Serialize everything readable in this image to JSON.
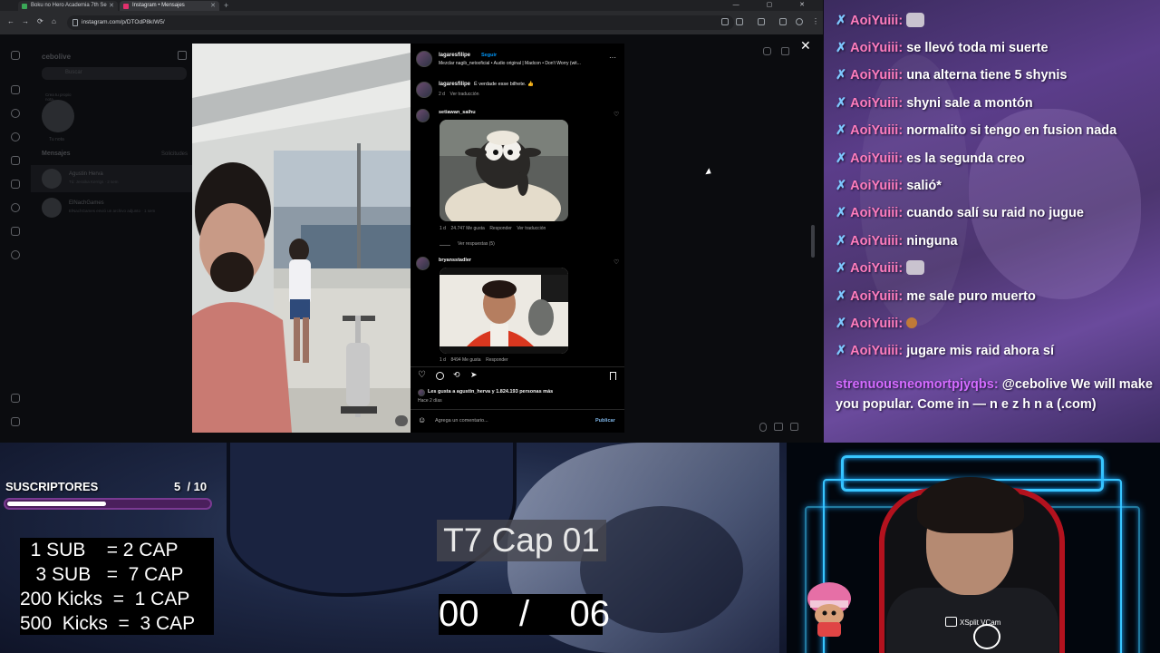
{
  "browser": {
    "tabs": [
      {
        "label": "Boku no Hero Academia 7th Se",
        "color": "#3aa757"
      },
      {
        "label": "Instagram • Mensajes",
        "color": "#e1306c"
      }
    ],
    "newtab": "+",
    "window_controls": "— ▢ ✕",
    "url": "instagram.com/p/DTOdP8kIW5/",
    "nav": {
      "back": "←",
      "forward": "→",
      "reload": "⟳",
      "home": "⌂"
    }
  },
  "instagram": {
    "username": "cebolive",
    "search_placeholder": "Buscar",
    "note_text": "Crea tu propio nota...",
    "note_user": "Tu nota",
    "messages_heading": "Mensajes",
    "requests_label": "Solicitudes",
    "conversations": [
      {
        "name": "Agustin Herva",
        "preview": "Tú: Jessika Kerrigs · 2 sem"
      },
      {
        "name": "ElNachGames",
        "preview": "ElNachGames envió un archivo adjunto · 1 sem"
      }
    ],
    "modal_close": "✕",
    "post": {
      "author": "lagaresfilipe",
      "follow": "Seguir",
      "audio": "Mezclar nagib_netooficial • Audio original | Madcon • Don't Worry (wit...",
      "more": "···",
      "caption_user": "lagaresfilipe",
      "caption": "É verdade esse bilhete. 👍",
      "caption_meta": "2 d    Ver traducción",
      "comments": [
        {
          "user": "setiawan_saihu",
          "meta": "1 d    24.747 Me gusta    Responder    Ver traducción",
          "replies": "Ver respuestas (5)"
        },
        {
          "user": "bryansstadler",
          "meta": "1 d    8494 Me gusta    Responder"
        }
      ],
      "likes": "Les gusta a agustin_herva y 1.824.193 personas más",
      "date": "Hace 2 días",
      "comment_placeholder": "Agrega un comentario...",
      "publish": "Publicar"
    }
  },
  "chat": {
    "messages": [
      {
        "user": "AoiYuiii:",
        "text": "",
        "emote": "cat-emote"
      },
      {
        "user": "AoiYuiii:",
        "text": "se llevó toda mi suerte"
      },
      {
        "user": "AoiYuiii:",
        "text": "una alterna tiene 5 shynis"
      },
      {
        "user": "AoiYuiii:",
        "text": "shyni sale a montón"
      },
      {
        "user": "AoiYuiii:",
        "text": "normalito si tengo en fusion nada"
      },
      {
        "user": "AoiYuiii:",
        "text": "es la segunda creo"
      },
      {
        "user": "AoiYuiii:",
        "text": "salió*"
      },
      {
        "user": "AoiYuiii:",
        "text": "cuando salí su raid no jugue"
      },
      {
        "user": "AoiYuiii:",
        "text": "ninguna"
      },
      {
        "user": "AoiYuiii:",
        "text": "",
        "emote": "cat-emote"
      },
      {
        "user": "AoiYuiii:",
        "text": "me sale puro muerto"
      },
      {
        "user": "AoiYuiii:",
        "text": "",
        "emote": "cookie-emote"
      },
      {
        "user": "AoiYuiii:",
        "text": "jugare mis raid ahora sí"
      }
    ],
    "last": {
      "user": "strenuousneomortpjyqbs:",
      "text": "@cebolive We will make you popular. Come in — n e z h n a (.com)"
    }
  },
  "overlay": {
    "subs_title": "SUSCRIPTORES",
    "subs_count": "5  / 10",
    "subs_progress": 0.5,
    "rates": [
      "  1 SUB    = 2 CAP",
      "   3 SUB   =  7 CAP",
      "200 Kicks  =  1 CAP",
      "500  Kicks  =  3 CAP"
    ],
    "episode": "T7 Cap 01",
    "progress": "00    /    06"
  },
  "webcam": {
    "xsplit": "XSplit VCam"
  }
}
